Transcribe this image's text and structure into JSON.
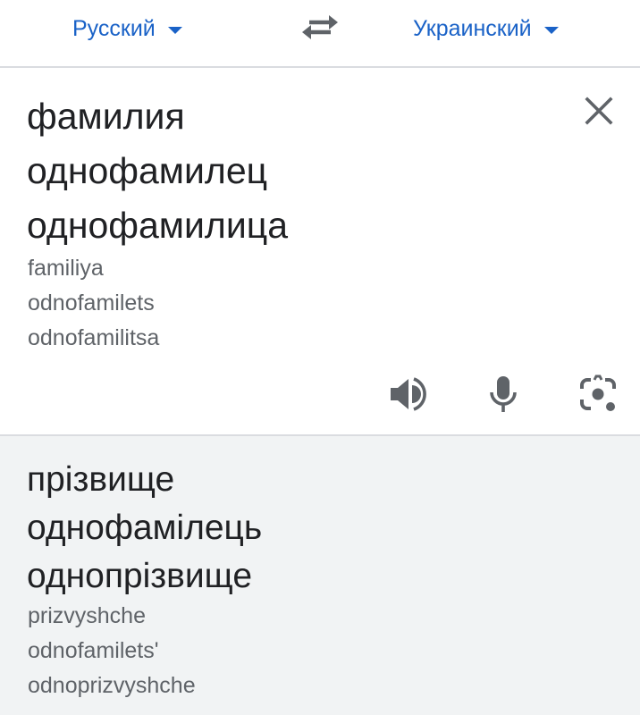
{
  "languages": {
    "source": "Русский",
    "target": "Украинский"
  },
  "source": {
    "text": "фамилия\nоднофамилец\nоднофамилица",
    "transliteration": "familiya\nodnofamilets\nodnofamilitsa"
  },
  "translation": {
    "text": "прізвище\nоднофамілець\nоднопрізвище",
    "transliteration": "prizvyshche\nodnofamilets'\nodnoprizvyshche"
  },
  "colors": {
    "accent": "#1a62c7",
    "text_primary": "#202124",
    "text_secondary": "#5f6368",
    "icon": "#5f6368",
    "translation_background": "#f1f3f4",
    "divider": "#dadce0"
  },
  "icons": {
    "swap": "swap-arrows-icon",
    "clear": "close-icon",
    "speak": "speaker-icon",
    "mic": "microphone-icon",
    "camera": "camera-lens-icon",
    "dropdown": "caret-down-icon"
  }
}
